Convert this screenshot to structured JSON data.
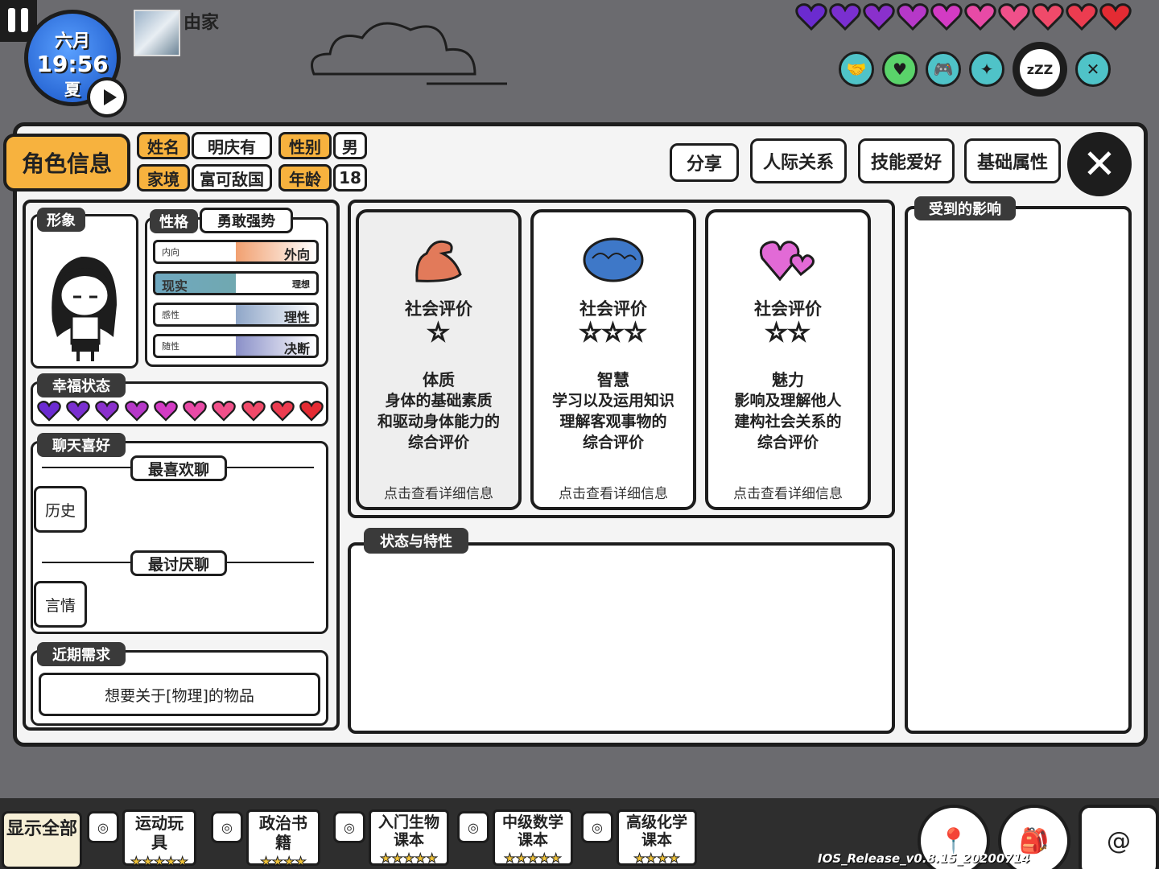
{
  "hud": {
    "month": "六月",
    "time": "19:56",
    "season": "夏",
    "player_name": "由家",
    "hearts": [
      "#6b2bd0",
      "#7a2fd0",
      "#8a30cc",
      "#b638c8",
      "#d33bc4",
      "#e84aa6",
      "#f0508a",
      "#f04a6a",
      "#ec3c50",
      "#e42b33"
    ],
    "icons": [
      "handshake-icon",
      "heart-icon",
      "gamepad-icon",
      "sparkle-icon",
      "sleep-icon",
      "fork-knife-icon"
    ],
    "sleep_text": "zZZ"
  },
  "header": {
    "role_tab": "角色信息",
    "name_label": "姓名",
    "name_value": "明庆有",
    "gender_label": "性别",
    "gender_value": "男",
    "family_label": "家境",
    "family_value": "富可敌国",
    "age_label": "年龄",
    "age_value": "18",
    "tabs": [
      "分享",
      "人际关系",
      "技能爱好",
      "基础属性"
    ],
    "close": "✕"
  },
  "left": {
    "image_title": "形象",
    "personality_title": "性格",
    "personality_value": "勇敢强势",
    "sliders": [
      {
        "left": "内向",
        "right": "外向",
        "value": 0.5,
        "color": "#f1a070",
        "emph": "right"
      },
      {
        "left": "现实",
        "right": "理想",
        "value": 0.5,
        "color": "#70a8b0",
        "emph": "left"
      },
      {
        "left": "感性",
        "right": "理性",
        "value": 0.5,
        "color": "#8fa6c8",
        "emph": "right"
      },
      {
        "left": "随性",
        "right": "决断",
        "value": 0.5,
        "color": "#8a90c8",
        "emph": "right"
      }
    ],
    "happiness_title": "幸福状态",
    "chat_title": "聊天喜好",
    "like_label": "最喜欢聊",
    "like_topic": "历史",
    "dislike_label": "最讨厌聊",
    "dislike_topic": "言情",
    "needs_title": "近期需求",
    "needs_value": "想要关于[物理]的物品"
  },
  "cards": [
    {
      "title": "社会评价",
      "stars": "☆",
      "name": "体质",
      "desc": "身体的基础素质\n和驱动身体能力的\n综合评价",
      "hint": "点击查看详细信息",
      "icon": "muscle-arm-icon"
    },
    {
      "title": "社会评价",
      "stars": "☆☆☆",
      "name": "智慧",
      "desc": "学习以及运用知识\n理解客观事物的\n综合评价",
      "hint": "点击查看详细信息",
      "icon": "brain-icon"
    },
    {
      "title": "社会评价",
      "stars": "☆☆",
      "name": "魅力",
      "desc": "影响及理解他人\n建构社会关系的\n综合评价",
      "hint": "点击查看详细信息",
      "icon": "hearts-icon"
    }
  ],
  "status_title": "状态与特性",
  "influence_title": "受到的影响",
  "bottom": {
    "show_all": "显示全部",
    "items": [
      {
        "name": "运动玩具",
        "stars": "★★★★★"
      },
      {
        "name": "政治书籍",
        "stars": "★★★★"
      },
      {
        "name": "入门生物课本",
        "stars": "★★★★★"
      },
      {
        "name": "中级数学课本",
        "stars": "★★★★★"
      },
      {
        "name": "高级化学课本",
        "stars": "★★★★"
      }
    ],
    "version": "IOS_Release_v0.8.15_20200714"
  }
}
